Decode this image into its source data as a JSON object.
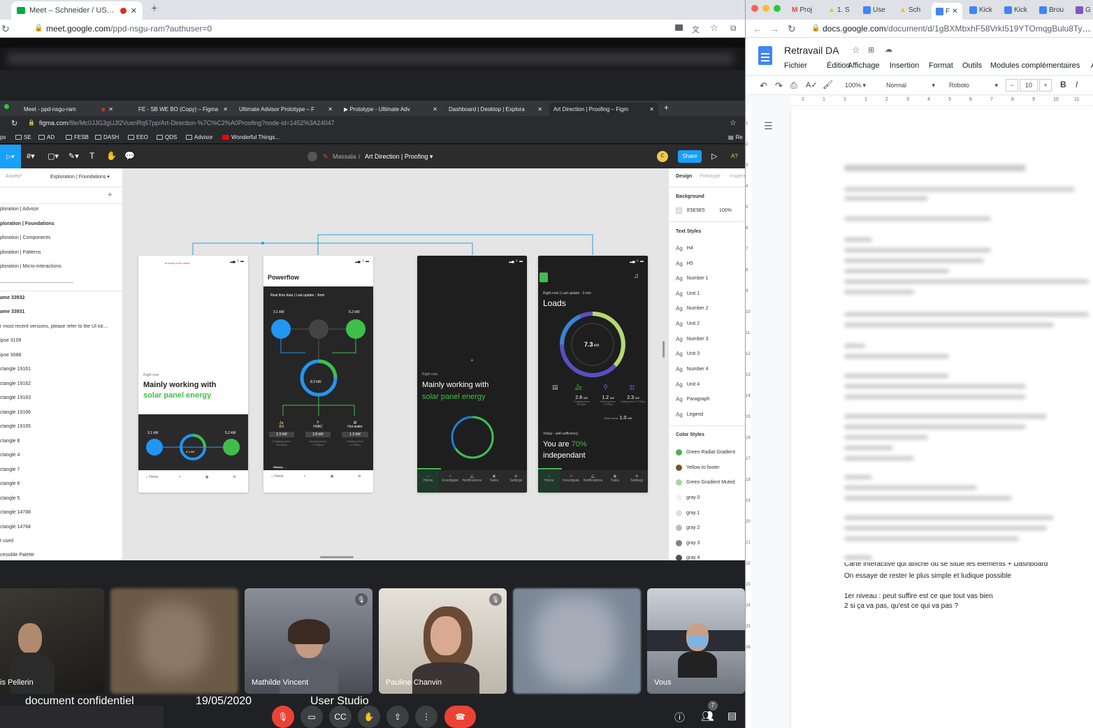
{
  "meet_window": {
    "tab_title": "Meet – Schneider / US - re",
    "url_domain": "meet.google.com",
    "url_path": "/ppd-nsgu-ram?authuser=0",
    "inner_tabs": [
      "Meet - ppd-nsgu-ram",
      "FE - SB WE BO (Copy) – Figma",
      "Ultimate Advisor Prototype – F",
      "▶︎ Prototype - Ultimate Adv",
      "Dashboard | Desktop | Explora",
      "Art Direction | Proofing – Figm"
    ],
    "inner_url_domain": "figma.com",
    "inner_url_path": "/file/Mc0JJG3gUJf2VusnRq57pp/Art-Direction-%7C%C2%A0Proofing?node-id=1452%3A24047",
    "bookmarks": [
      "ps",
      "SE",
      "AD",
      "FESB",
      "DASH",
      "EEO",
      "QDS",
      "Advisor",
      "Wonderful Things..."
    ],
    "bookmark_right": "Re"
  },
  "figma": {
    "breadcrumb_team": "Massala",
    "breadcrumb_file": "Art Direction | Proofing",
    "share_label": "Share",
    "zoom": "A?",
    "left_tabs": {
      "assets": "Assets",
      "page": "Exploration | Foundations"
    },
    "pages": [
      "ploration | Advisor",
      "ploration | Foundations",
      "ploration | Components",
      "ploration | Patterns",
      "ploration | Micro-interactions"
    ],
    "layers": [
      "ame 33932",
      "ame 33931",
      "r most recent versions, please refer to the UI kit:...",
      "ipse 3109",
      "ipse 3088",
      "ctangle 19161",
      "ctangle 19162",
      "ctangle 19163",
      "ctangle 19166",
      "ctangle 19165",
      "ctangle 8",
      "ctangle 4",
      "ctangle 7",
      "ctangle 6",
      "ctangle 5",
      "ctangle 14788",
      "ctangle 14784",
      "t used",
      "cessible Palette"
    ],
    "right_tabs": [
      "Design",
      "Prototype",
      "Inspect"
    ],
    "background_label": "Background",
    "background_hex": "E5E5E5",
    "background_opacity": "100%",
    "text_styles_label": "Text Styles",
    "text_styles": [
      "H4",
      "H5",
      "Number 1",
      "Unit 1",
      "Number 2",
      "Unit 2",
      "Number 3",
      "Unit 3",
      "Number 4",
      "Unit 4",
      "Paragraph",
      "Legend"
    ],
    "text_style_prefix": "Ag",
    "color_styles_label": "Color Styles",
    "color_styles": [
      {
        "name": "Green Radial Gradient",
        "color": "#4caf50"
      },
      {
        "name": "Yellow to footer",
        "color": "#6b5a1e"
      },
      {
        "name": "Green Gradient Muted",
        "color": "#a5d6a7"
      },
      {
        "name": "gray 0",
        "color": "#f2f2f2"
      },
      {
        "name": "gray 1",
        "color": "#e0e0e0"
      },
      {
        "name": "gray 2",
        "color": "#bdbdbd"
      },
      {
        "name": "gray 3",
        "color": "#828282"
      },
      {
        "name": "gray 4",
        "color": "#4f4f4f"
      }
    ]
  },
  "phones": {
    "p1": {
      "alert": "● Accès proto alerte",
      "right_now": "Right now",
      "line1": "Mainly working with",
      "line2": "solar panel energy",
      "left_kw": "3.1 kW",
      "right_kw": "5.2 kW",
      "center_kw": "8.3 kW",
      "nav": [
        "Home",
        "",
        "",
        ""
      ]
    },
    "p2": {
      "title": "Powerflow",
      "subtitle": "Real time data | Last update : 3min",
      "left_kw": "3.1 kW",
      "right_kw": "5.2 kW",
      "center_kw": "8.3 kW",
      "loads": [
        {
          "name": "EV",
          "value": "2.3 kW",
          "since": "Charging since 16:00pm"
        },
        {
          "name": "HVAC",
          "value": "2.8 kW",
          "since": "Working since 17:00pm"
        },
        {
          "name": "Hot water",
          "value": "1.2 kW",
          "since": "Heating since 17:00pm"
        }
      ],
      "history": "History →",
      "nav": [
        "Home",
        "",
        "",
        ""
      ]
    },
    "p3": {
      "right_now": "Right now",
      "line1": "Mainly working with",
      "line2": "solar panel energy",
      "nav": [
        "Home",
        "Investigate",
        "Notifications",
        "Tasks",
        "Settings"
      ]
    },
    "p4": {
      "subtitle": "Right now | Last update : 3 min",
      "title": "Loads",
      "center_value": "7.3",
      "center_unit": "kW",
      "loads": [
        {
          "value": "2.8",
          "since": "Charging since 16:00pm"
        },
        {
          "value": "1.2",
          "since": "Working since 17:00pm"
        },
        {
          "value": "2.3",
          "since": "Heating since 17:00pm"
        }
      ],
      "unit": "kW",
      "other_label": "Other loads",
      "other_value": "1.0",
      "today": "Today - self-sufficiency",
      "you_are": "You are",
      "percent": "70%",
      "independant": "independant",
      "nav": [
        "Home",
        "Investigate",
        "Notifications",
        "Tasks",
        "Settings"
      ]
    }
  },
  "participants": [
    {
      "name": "is Pellerin",
      "muted": false
    },
    {
      "name": "",
      "muted": false
    },
    {
      "name": "Mathilde Vincent",
      "muted": true
    },
    {
      "name": "Pauline Chanvin",
      "muted": true
    },
    {
      "name": "",
      "muted": false
    },
    {
      "name": "Vous",
      "muted": false
    }
  ],
  "captions": {
    "left": "document confidentiel",
    "date": "19/05/2020",
    "studio": "User Studio"
  },
  "people_count": "7",
  "docs_window": {
    "tabs": [
      "Proj",
      "1. S",
      "Use",
      "Sch",
      "F",
      "Kick",
      "Kick",
      "Brou",
      "G"
    ],
    "url_domain": "docs.google.com",
    "url_path": "/document/d/1gBXMbxhF58VrkI519YTOmqgBulu8TyCEFbg",
    "doc_title": "Retravail DA",
    "menus": [
      "Fichier",
      "Édition",
      "Affichage",
      "Insertion",
      "Format",
      "Outils",
      "Modules complémentaires",
      "A"
    ],
    "zoom": "100%",
    "style": "Normal",
    "font": "Roboto",
    "font_size": "10",
    "bold": "B",
    "italic": "I",
    "ruler": [
      "2",
      "1",
      "1",
      "1",
      "2",
      "3",
      "4",
      "5",
      "6",
      "7",
      "8",
      "9",
      "10",
      "11"
    ],
    "vruler": [
      "1",
      "2",
      "3",
      "4",
      "5",
      "6",
      "7",
      "8",
      "9",
      "10",
      "11",
      "12",
      "13",
      "14",
      "15",
      "16",
      "17",
      "18",
      "19",
      "20",
      "21",
      "22",
      "23",
      "24",
      "25",
      "26"
    ],
    "visible_text": [
      "Carte interactive qui affiche où se situe les éléments + Dashboard",
      "On essaye de rester le plus simple et ludique possible",
      "1er niveau : peut suffire est ce que tout vas bien",
      "2 si ça va pas, qu'est ce qui va pas ?"
    ]
  }
}
